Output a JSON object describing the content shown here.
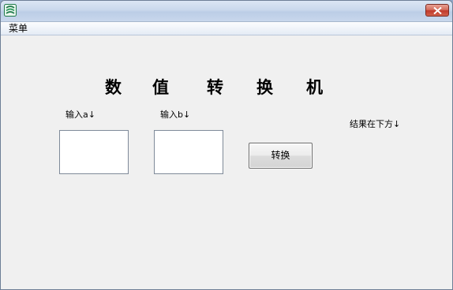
{
  "window": {
    "close_label": "Close"
  },
  "menu": {
    "item": "菜单"
  },
  "main": {
    "title_chars": [
      "数",
      "值",
      "转",
      "换",
      "机"
    ],
    "input_a_label": "输入a↓",
    "input_b_label": "输入b↓",
    "input_a_value": "",
    "input_b_value": "",
    "convert_button": "转换",
    "result_label": "结果在下方↓"
  },
  "icons": {
    "app": "app-icon",
    "close": "close-icon"
  },
  "colors": {
    "title_bar": "#c9d8ec",
    "close_button": "#c0392b",
    "client_bg": "#f0f0f0",
    "input_bg": "#ffffff"
  }
}
